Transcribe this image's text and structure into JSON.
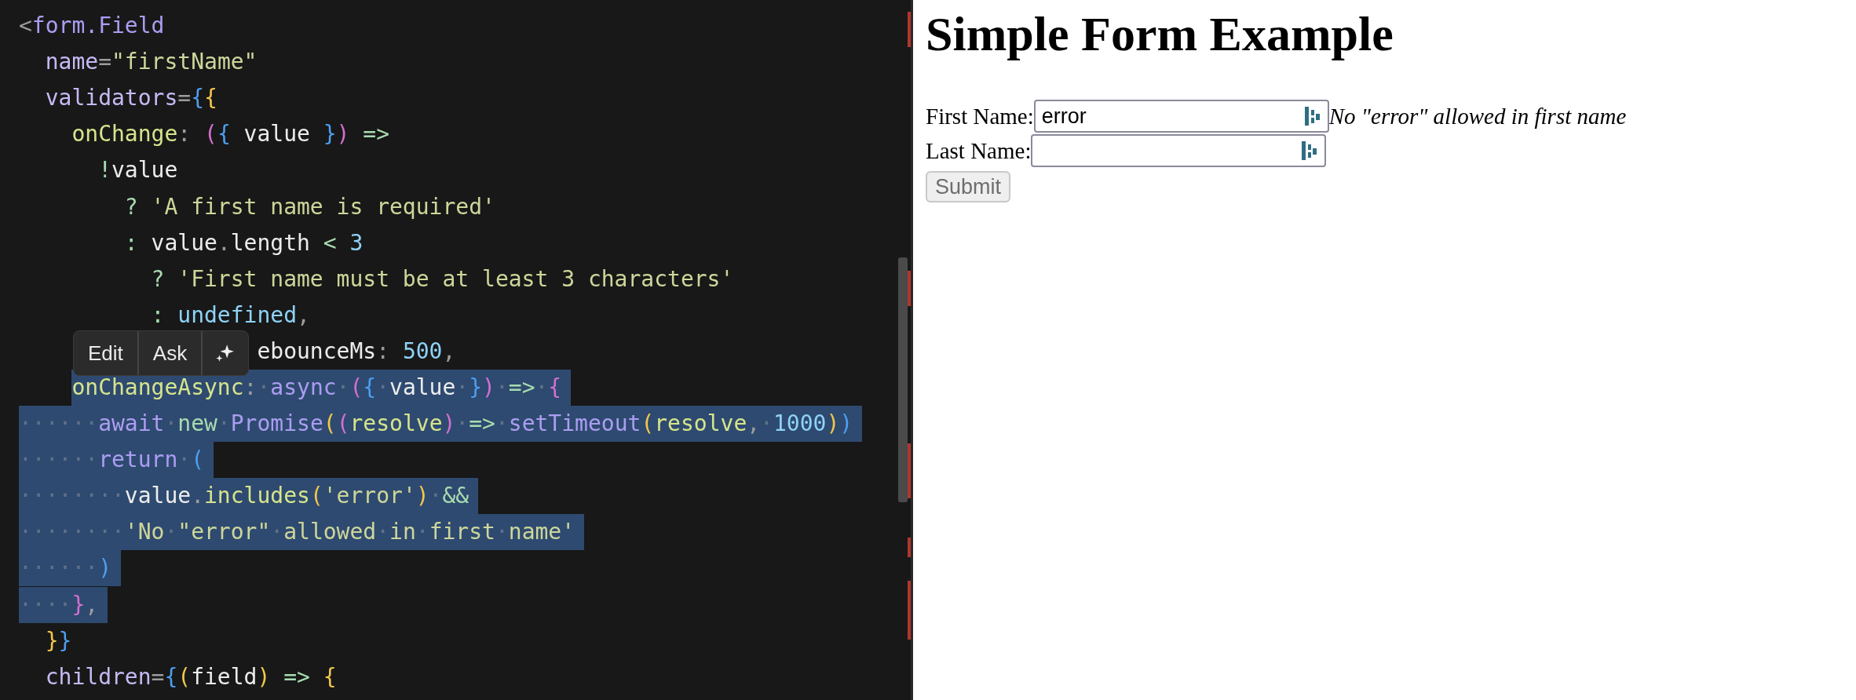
{
  "editor": {
    "lines": [
      {
        "selected": false,
        "tokens": [
          {
            "text": "<",
            "kind": "p"
          },
          {
            "text": "form.Field",
            "kind": "tag"
          }
        ]
      },
      {
        "selected": false,
        "tokens": [
          {
            "text": "  name",
            "kind": "attr"
          },
          {
            "text": "=",
            "kind": "p"
          },
          {
            "text": "\"firstName\"",
            "kind": "str"
          }
        ]
      },
      {
        "selected": false,
        "tokens": [
          {
            "text": "  validators",
            "kind": "attr"
          },
          {
            "text": "=",
            "kind": "p"
          },
          {
            "text": "{",
            "kind": "b"
          },
          {
            "text": "{",
            "kind": "y"
          }
        ]
      },
      {
        "selected": false,
        "tokens": [
          {
            "text": "    onChange",
            "kind": "fn"
          },
          {
            "text": ": ",
            "kind": "p"
          },
          {
            "text": "(",
            "kind": "m"
          },
          {
            "text": "{",
            "kind": "b"
          },
          {
            "text": " value ",
            "kind": "id"
          },
          {
            "text": "}",
            "kind": "b"
          },
          {
            "text": ")",
            "kind": "m"
          },
          {
            "text": " =>",
            "kind": "op"
          }
        ]
      },
      {
        "selected": false,
        "tokens": [
          {
            "text": "      !",
            "kind": "op"
          },
          {
            "text": "value",
            "kind": "id"
          }
        ]
      },
      {
        "selected": false,
        "tokens": [
          {
            "text": "        ? ",
            "kind": "op"
          },
          {
            "text": "'A first name is required'",
            "kind": "str"
          }
        ]
      },
      {
        "selected": false,
        "tokens": [
          {
            "text": "        : ",
            "kind": "op"
          },
          {
            "text": "value",
            "kind": "id"
          },
          {
            "text": ".",
            "kind": "p"
          },
          {
            "text": "length",
            "kind": "id"
          },
          {
            "text": " < ",
            "kind": "op"
          },
          {
            "text": "3",
            "kind": "num"
          }
        ]
      },
      {
        "selected": false,
        "tokens": [
          {
            "text": "          ? ",
            "kind": "op"
          },
          {
            "text": "'First name must be at least 3 characters'",
            "kind": "str"
          }
        ]
      },
      {
        "selected": false,
        "tokens": [
          {
            "text": "          : ",
            "kind": "op"
          },
          {
            "text": "undefined",
            "kind": "num"
          },
          {
            "text": ",",
            "kind": "p"
          }
        ]
      },
      {
        "selected": false,
        "tokens": [
          {
            "text": "                  ebounceMs",
            "kind": "id"
          },
          {
            "text": ": ",
            "kind": "p"
          },
          {
            "text": "500",
            "kind": "num"
          },
          {
            "text": ",",
            "kind": "p"
          }
        ]
      },
      {
        "selected": true,
        "tokens": [
          {
            "text": "    onChangeAsync",
            "kind": "fn"
          },
          {
            "text": ":",
            "kind": "p"
          },
          {
            "text": "·",
            "kind": "ws"
          },
          {
            "text": "async",
            "kind": "kw"
          },
          {
            "text": "·",
            "kind": "ws"
          },
          {
            "text": "(",
            "kind": "m"
          },
          {
            "text": "{",
            "kind": "b"
          },
          {
            "text": "·",
            "kind": "ws"
          },
          {
            "text": "value",
            "kind": "id"
          },
          {
            "text": "·",
            "kind": "ws"
          },
          {
            "text": "}",
            "kind": "b"
          },
          {
            "text": ")",
            "kind": "m"
          },
          {
            "text": "·",
            "kind": "ws"
          },
          {
            "text": "=>",
            "kind": "op"
          },
          {
            "text": "·",
            "kind": "ws"
          },
          {
            "text": "{",
            "kind": "m"
          }
        ]
      },
      {
        "selected": true,
        "tokens": [
          {
            "text": "······",
            "kind": "ws"
          },
          {
            "text": "await",
            "kind": "kw"
          },
          {
            "text": "·",
            "kind": "ws"
          },
          {
            "text": "new",
            "kind": "op"
          },
          {
            "text": "·",
            "kind": "ws"
          },
          {
            "text": "Promise",
            "kind": "kw"
          },
          {
            "text": "(",
            "kind": "y"
          },
          {
            "text": "(",
            "kind": "m"
          },
          {
            "text": "resolve",
            "kind": "fn"
          },
          {
            "text": ")",
            "kind": "m"
          },
          {
            "text": "·",
            "kind": "ws"
          },
          {
            "text": "=>",
            "kind": "op"
          },
          {
            "text": "·",
            "kind": "ws"
          },
          {
            "text": "setTimeout",
            "kind": "kw"
          },
          {
            "text": "(",
            "kind": "y"
          },
          {
            "text": "resolve",
            "kind": "fn"
          },
          {
            "text": ",",
            "kind": "p"
          },
          {
            "text": "·",
            "kind": "ws"
          },
          {
            "text": "1000",
            "kind": "num"
          },
          {
            "text": ")",
            "kind": "y"
          },
          {
            "text": ")",
            "kind": "b"
          }
        ]
      },
      {
        "selected": true,
        "tokens": [
          {
            "text": "······",
            "kind": "ws"
          },
          {
            "text": "return",
            "kind": "kw"
          },
          {
            "text": "·",
            "kind": "ws"
          },
          {
            "text": "(",
            "kind": "b"
          }
        ]
      },
      {
        "selected": true,
        "tokens": [
          {
            "text": "········",
            "kind": "ws"
          },
          {
            "text": "value",
            "kind": "id"
          },
          {
            "text": ".",
            "kind": "p"
          },
          {
            "text": "includes",
            "kind": "fn"
          },
          {
            "text": "(",
            "kind": "y"
          },
          {
            "text": "'error'",
            "kind": "str"
          },
          {
            "text": ")",
            "kind": "y"
          },
          {
            "text": "·",
            "kind": "ws"
          },
          {
            "text": "&&",
            "kind": "op"
          }
        ]
      },
      {
        "selected": true,
        "tokens": [
          {
            "text": "········",
            "kind": "ws"
          },
          {
            "text": "'No",
            "kind": "str"
          },
          {
            "text": "·",
            "kind": "ws"
          },
          {
            "text": "\"error\"",
            "kind": "str"
          },
          {
            "text": "·",
            "kind": "ws"
          },
          {
            "text": "allowed",
            "kind": "str"
          },
          {
            "text": "·",
            "kind": "ws"
          },
          {
            "text": "in",
            "kind": "str"
          },
          {
            "text": "·",
            "kind": "ws"
          },
          {
            "text": "first",
            "kind": "str"
          },
          {
            "text": "·",
            "kind": "ws"
          },
          {
            "text": "name'",
            "kind": "str"
          }
        ]
      },
      {
        "selected": true,
        "tokens": [
          {
            "text": "······",
            "kind": "ws"
          },
          {
            "text": ")",
            "kind": "b"
          }
        ]
      },
      {
        "selected": true,
        "tokens": [
          {
            "text": "····",
            "kind": "ws"
          },
          {
            "text": "}",
            "kind": "m"
          },
          {
            "text": ",",
            "kind": "p"
          }
        ]
      },
      {
        "selected": false,
        "tokens": [
          {
            "text": "  }",
            "kind": "y"
          },
          {
            "text": "}",
            "kind": "b"
          }
        ]
      },
      {
        "selected": false,
        "tokens": [
          {
            "text": "  children",
            "kind": "attr"
          },
          {
            "text": "=",
            "kind": "p"
          },
          {
            "text": "{",
            "kind": "b"
          },
          {
            "text": "(",
            "kind": "y"
          },
          {
            "text": "field",
            "kind": "id"
          },
          {
            "text": ")",
            "kind": "y"
          },
          {
            "text": " => ",
            "kind": "op"
          },
          {
            "text": "{",
            "kind": "y"
          }
        ]
      }
    ]
  },
  "toolbar": {
    "buttons": [
      {
        "kind": "text",
        "label": "Edit"
      },
      {
        "kind": "text",
        "label": "Ask"
      },
      {
        "kind": "sparkle"
      }
    ]
  },
  "preview": {
    "title": "Simple Form Example",
    "fields": [
      {
        "label": "First Name:",
        "value": "error",
        "error": "No \"error\" allowed in first name"
      },
      {
        "label": "Last Name:"
      }
    ],
    "submit": {
      "label": "Submit",
      "disabled": true
    }
  }
}
